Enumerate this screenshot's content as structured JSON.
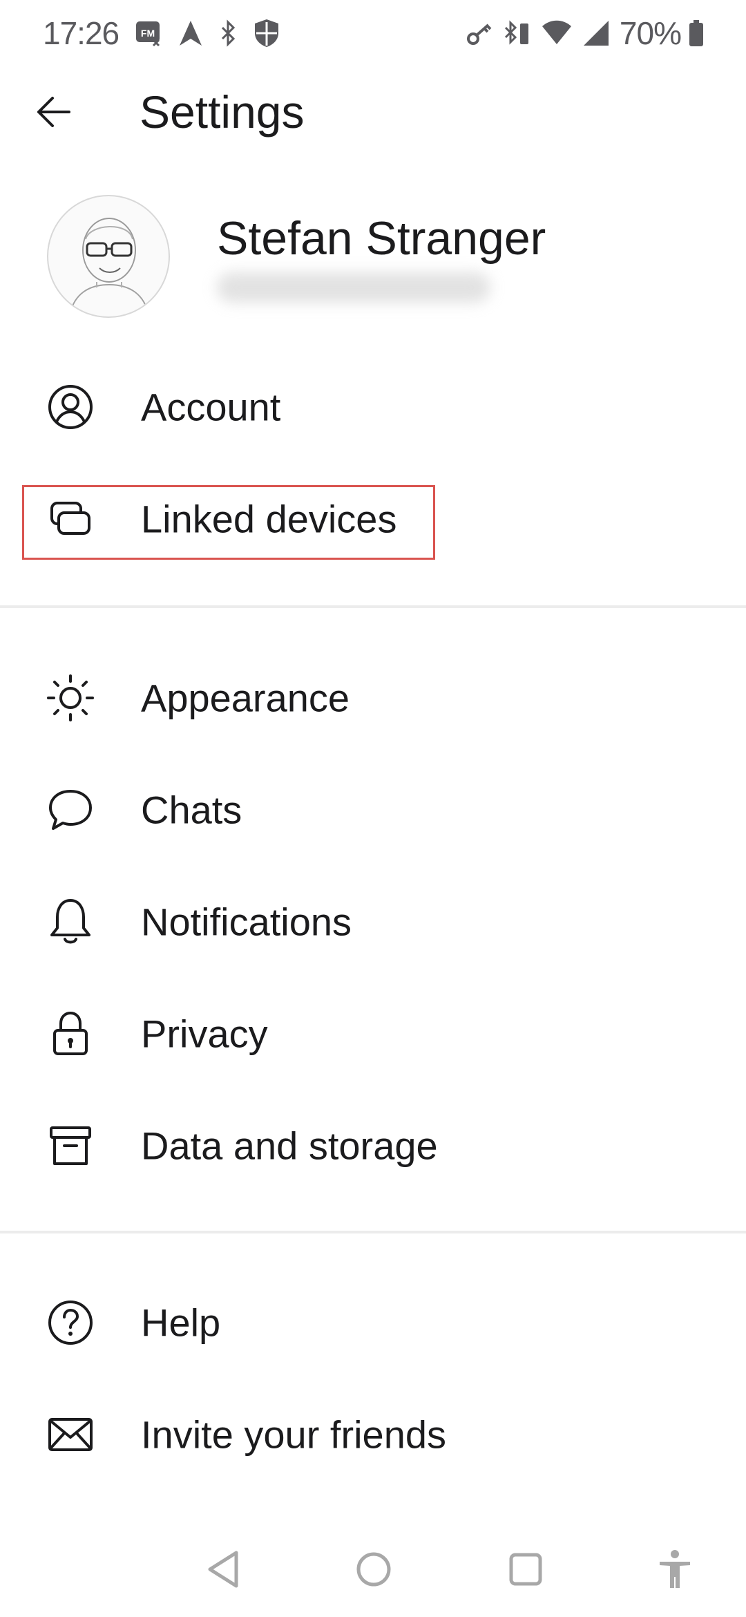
{
  "status_bar": {
    "time": "17:26",
    "battery_percent": "70%",
    "left_icons": [
      "fm-radio-icon",
      "navigation-arrow-icon",
      "bluetooth-icon",
      "shield-icon"
    ],
    "right_icons": [
      "vpn-key-icon",
      "bluetooth-battery-icon",
      "wifi-icon",
      "signal-icon",
      "battery-icon"
    ]
  },
  "app_bar": {
    "title": "Settings",
    "back_icon": "arrow-back-icon"
  },
  "profile": {
    "name": "Stefan Stranger"
  },
  "menu": {
    "section1": [
      {
        "label": "Account",
        "icon": "account-circle-icon"
      },
      {
        "label": "Linked devices",
        "icon": "linked-devices-icon"
      }
    ],
    "section2": [
      {
        "label": "Appearance",
        "icon": "sun-icon"
      },
      {
        "label": "Chats",
        "icon": "chat-bubble-icon"
      },
      {
        "label": "Notifications",
        "icon": "bell-icon"
      },
      {
        "label": "Privacy",
        "icon": "lock-icon"
      },
      {
        "label": "Data and storage",
        "icon": "archive-box-icon"
      }
    ],
    "section3": [
      {
        "label": "Help",
        "icon": "help-circle-icon"
      },
      {
        "label": "Invite your friends",
        "icon": "envelope-icon"
      }
    ]
  },
  "highlight_color": "#d9534f",
  "nav_bar": {
    "icons": [
      "nav-back-icon",
      "nav-home-icon",
      "nav-recents-icon",
      "accessibility-icon"
    ]
  }
}
